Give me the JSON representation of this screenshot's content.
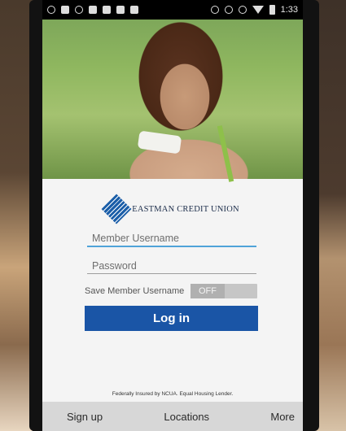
{
  "status_bar": {
    "time": "1:33",
    "left_icons": [
      "alarm-icon",
      "wrench-icon",
      "info-icon",
      "lock-icon",
      "image-icon",
      "camera-icon",
      "android-icon"
    ],
    "right_icons": [
      "bluetooth-icon",
      "minus-circle-icon",
      "alarm-icon",
      "wifi-icon",
      "battery-icon"
    ]
  },
  "brand": {
    "name": "EASTMAN CREDIT UNION",
    "color": "#1b5ea8"
  },
  "login": {
    "username_placeholder": "Member Username",
    "password_placeholder": "Password",
    "save_label": "Save Member Username",
    "save_state": "OFF",
    "login_button": "Log in",
    "button_color": "#1a55a6"
  },
  "footer_note": "Federally Insured by NCUA. Equal Housing Lender.",
  "bottom_nav": [
    {
      "label": "Sign up"
    },
    {
      "label": "Locations"
    },
    {
      "label": "More"
    }
  ]
}
